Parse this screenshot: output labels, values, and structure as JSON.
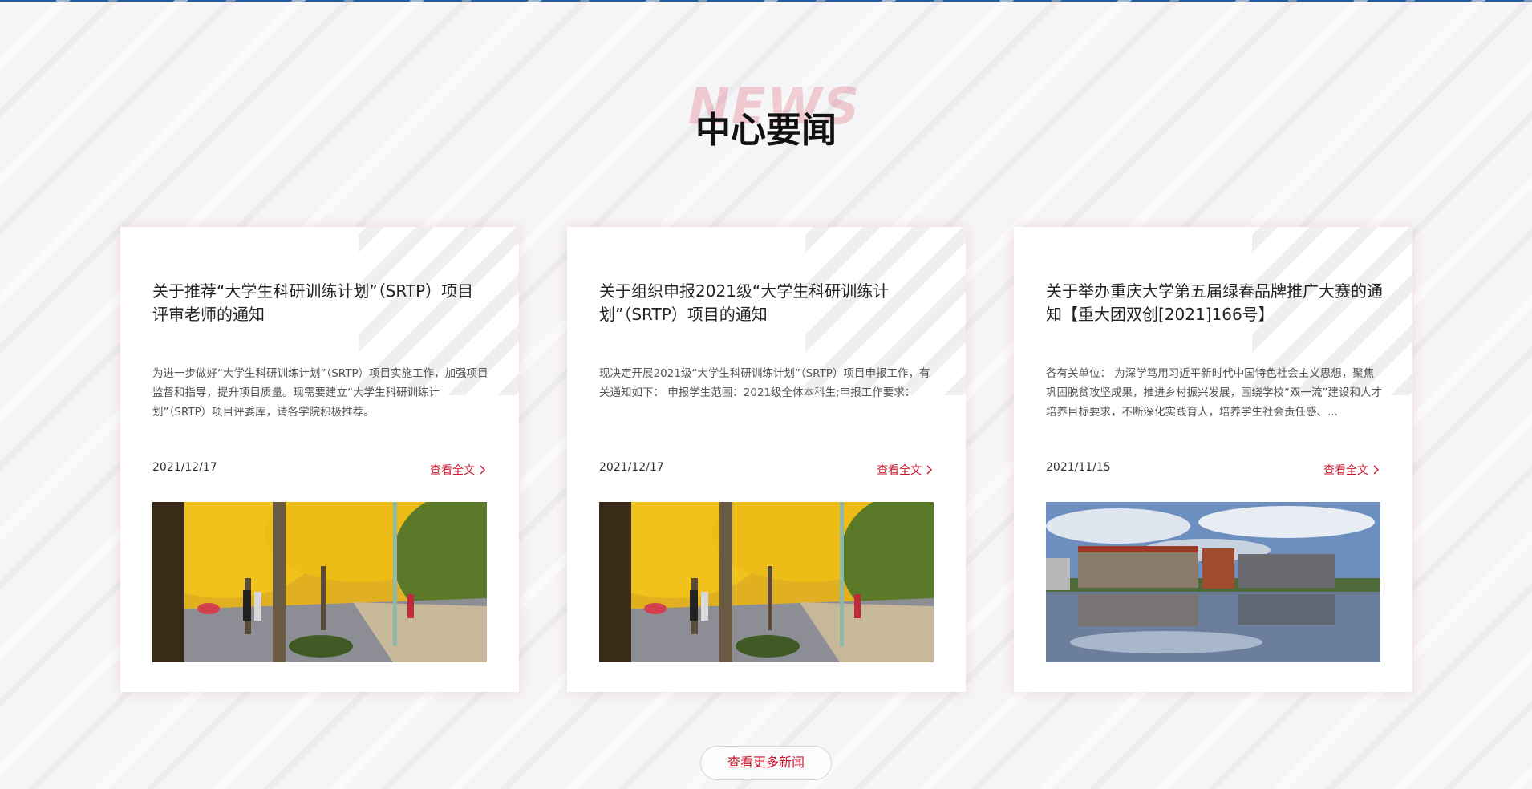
{
  "section": {
    "watermark": "NEWS",
    "title": "中心要闻"
  },
  "news": [
    {
      "title": "关于推荐“大学生科研训练计划”（SRTP）项目评审老师的通知",
      "summary": "为进一步做好“大学生科研训练计划”（SRTP）项目实施工作，加强项目监督和指导，提升项目质量。现需要建立“大学生科研训练计划”（SRTP）项目评委库，请各学院积极推荐。",
      "date": "2021/12/17",
      "more": "查看全文",
      "image": "campus-ginkgo-avenue"
    },
    {
      "title": "关于组织申报2021级“大学生科研训练计划”（SRTP）项目的通知",
      "summary": "现决定开展2021级“大学生科研训练计划”（SRTP）项目申报工作，有关通知如下： 申报学生范围：2021级全体本科生;申报工作要求：",
      "date": "2021/12/17",
      "more": "查看全文",
      "image": "campus-ginkgo-avenue"
    },
    {
      "title": "关于举办重庆大学第五届绿春品牌推广大赛的通知【重大团双创[2021]166号】",
      "summary": "各有关单位： 为深学笃用习近平新时代中国特色社会主义思想，聚焦巩固脱贫攻坚成果，推进乡村振兴发展，围绕学校“双一流”建设和人才培养目标要求，不断深化实践育人，培养学生社会责任感、...",
      "date": "2021/11/15",
      "more": "查看全文",
      "image": "campus-building-lake"
    }
  ],
  "more_news_label": "查看更多新闻",
  "colors": {
    "accent": "#c8152d",
    "top_line": "#1f5d9e",
    "background": "#f5f4f6"
  }
}
